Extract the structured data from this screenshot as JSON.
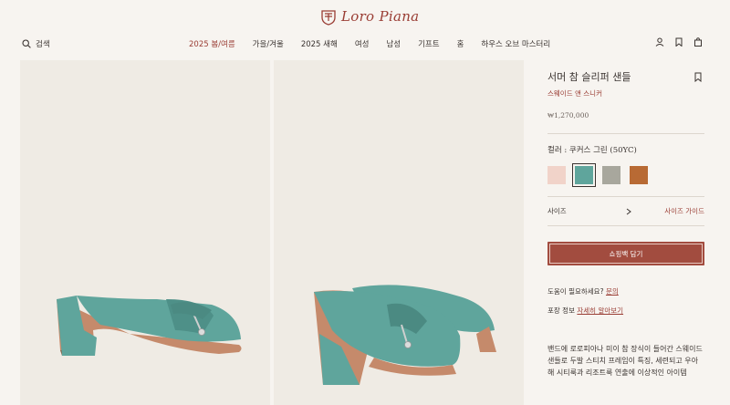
{
  "brand": {
    "logo_text": "Loro Piana",
    "color": "#9a3d34"
  },
  "header": {
    "search_label": "검색",
    "nav": [
      "2025 봄/여름",
      "가을/겨울",
      "2025 새해",
      "여성",
      "남성",
      "기프트",
      "홈",
      "하우스 오브 마스터리"
    ],
    "active_index": 0,
    "icons": [
      "account-icon",
      "wishlist-icon",
      "bag-icon"
    ]
  },
  "product": {
    "title": "서머 참 슬리퍼 샌들",
    "subtitle": "스웨이드 앤 스니커",
    "price": "₩1,270,000",
    "color_label": "컬러 : 쿠커스 그린 (50YC)",
    "swatches": [
      {
        "name": "pink",
        "color": "#f1d3c9"
      },
      {
        "name": "teal",
        "color": "#5fa59c",
        "selected": true
      },
      {
        "name": "grey",
        "color": "#a8a79d"
      },
      {
        "name": "cognac",
        "color": "#b86a34"
      }
    ],
    "size_label": "사이즈",
    "size_guide": "사이즈 가이드",
    "cart_button": "쇼핑백 담기",
    "help_text": "도움이 필요하세요?",
    "help_link": "문의",
    "care_text": "포장 정보",
    "care_link": "자세히 알아보기",
    "description": "밴드에 로로피아나 미이 참 장식이 들어간 스웨이드 샌들로 두발 스티치 프레임이 특징, 세련되고 우아해 시티룩과 리조트룩 연출에 이상적인 아이템"
  },
  "colors": {
    "accent": "#9a3d34",
    "button": "#a24c3f",
    "background": "#f7f4f0",
    "panel": "#efebe4",
    "suede": "#5fa59c",
    "sole": "#c58a6b"
  }
}
